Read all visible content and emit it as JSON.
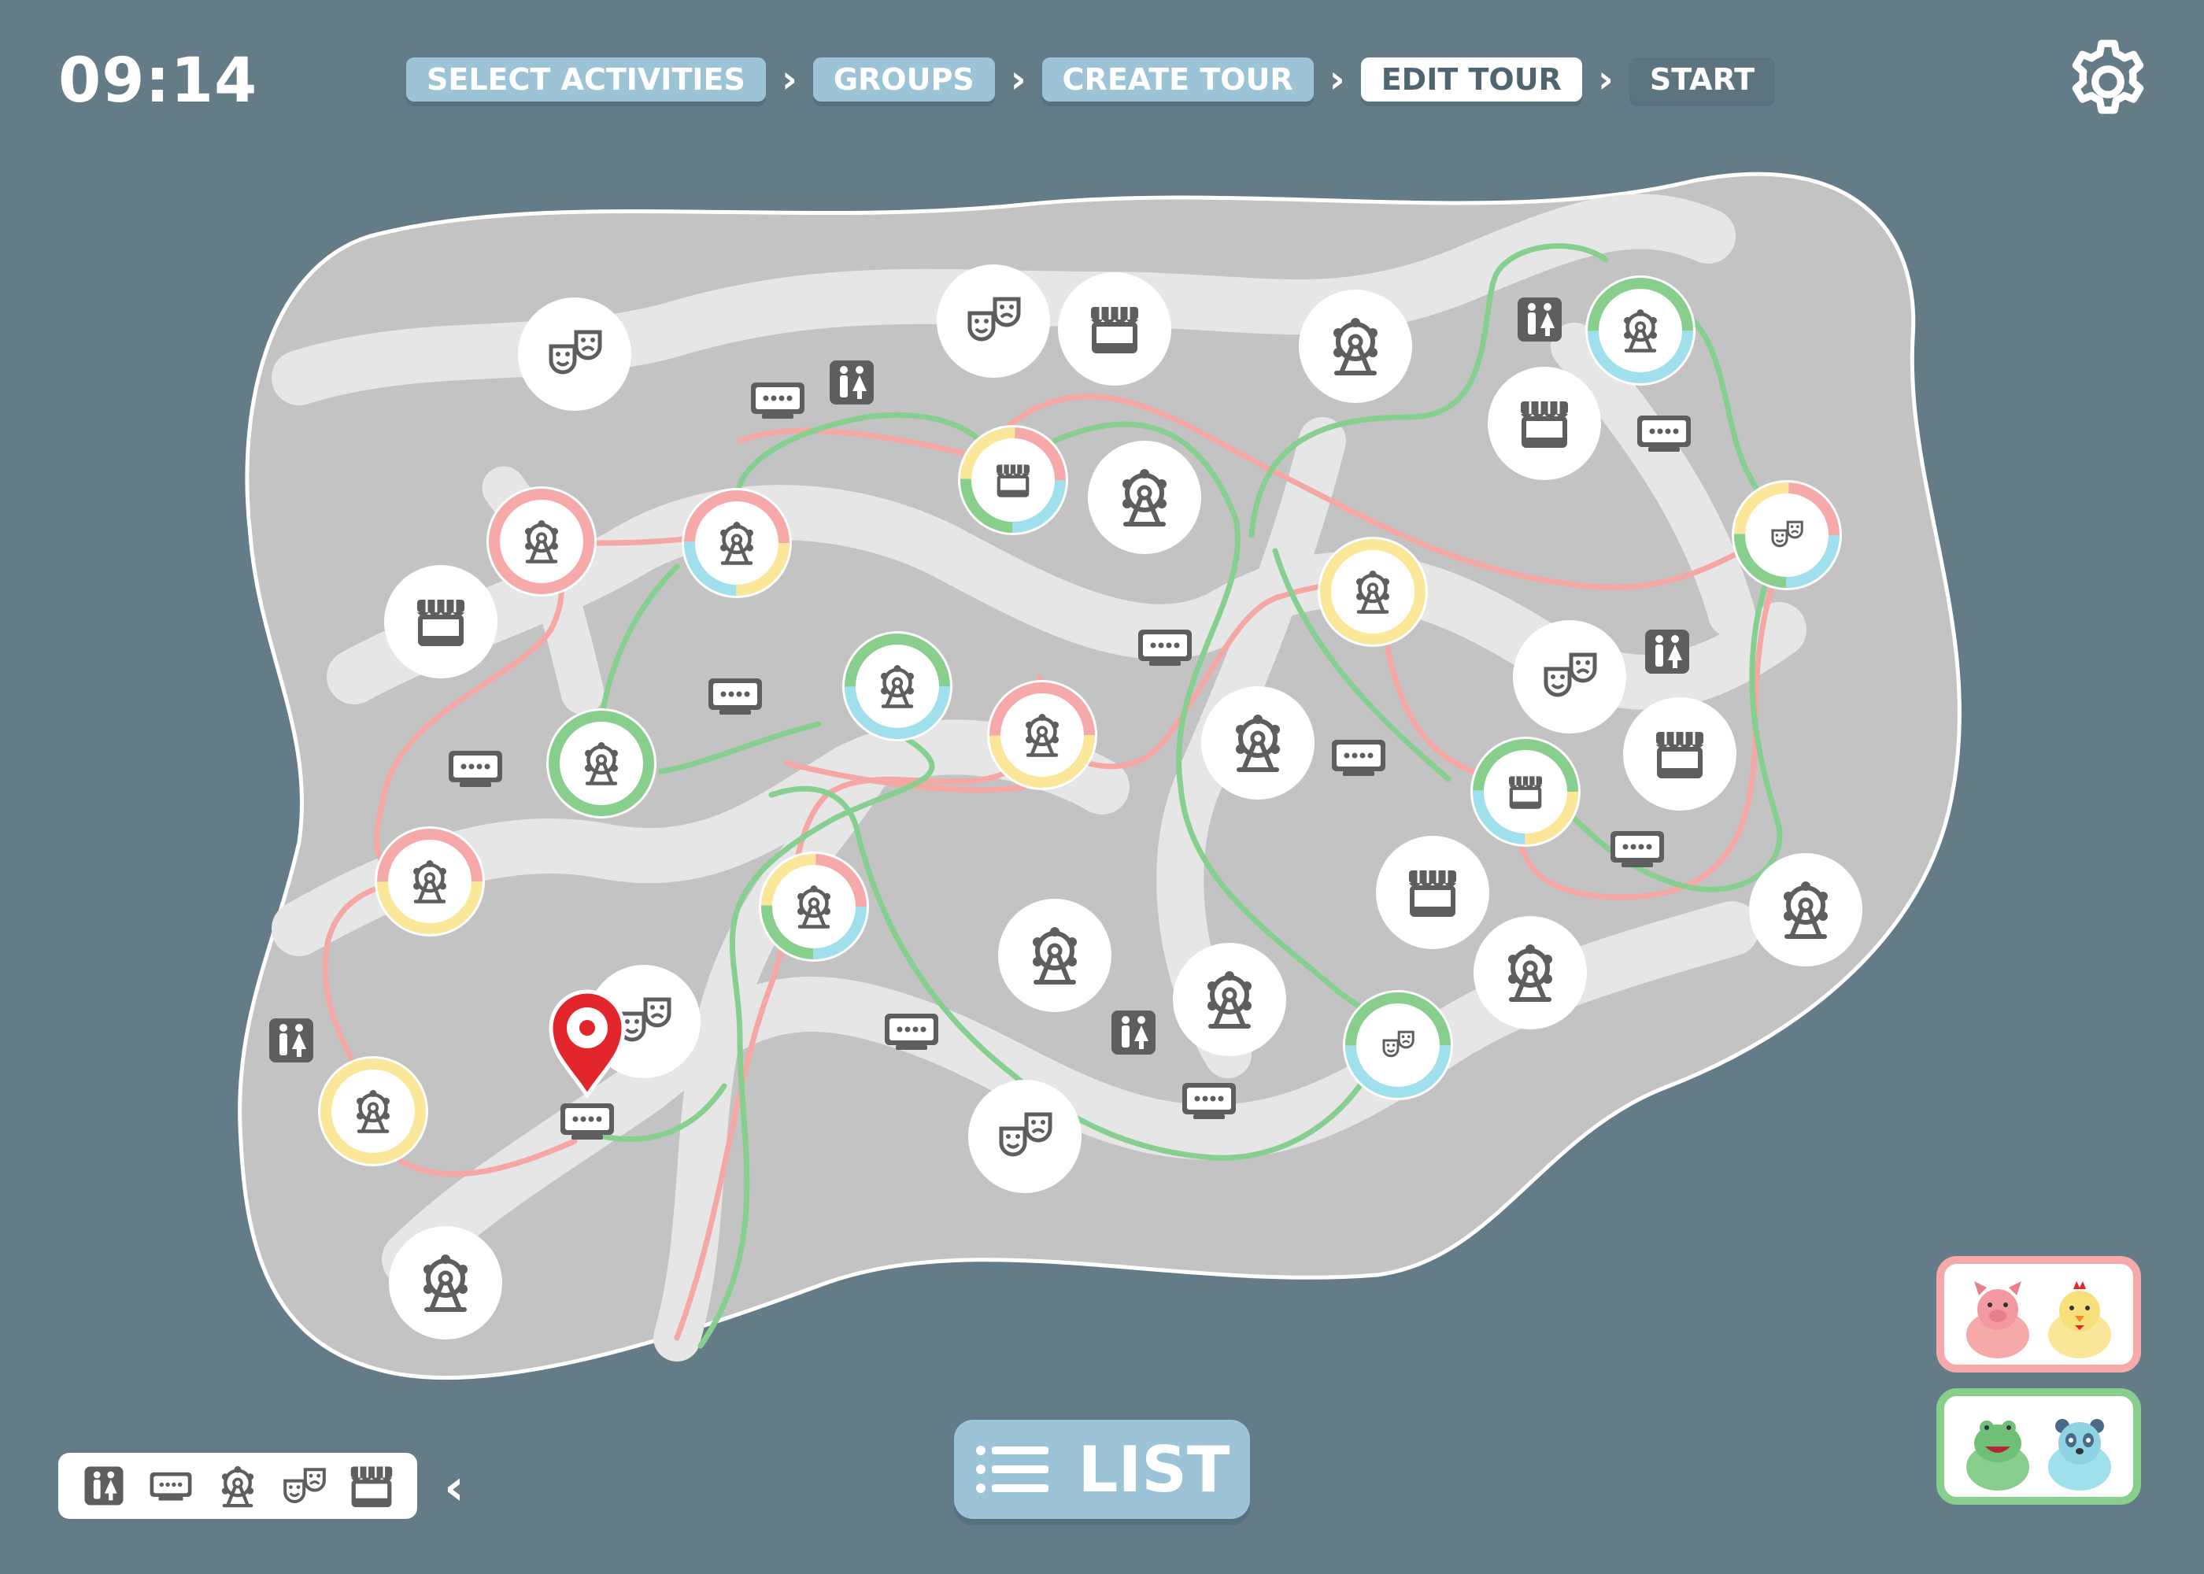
{
  "header": {
    "time": "09:14",
    "steps": [
      {
        "label": "SELECT ACTIVITIES",
        "state": "done"
      },
      {
        "label": "GROUPS",
        "state": "done"
      },
      {
        "label": "CREATE TOUR",
        "state": "done"
      },
      {
        "label": "EDIT TOUR",
        "state": "current"
      },
      {
        "label": "START",
        "state": "pending"
      }
    ],
    "settings_icon": "gear-icon"
  },
  "colors": {
    "background": "#647b88",
    "map_land": "#c3c3c3",
    "map_paths": "#e6e6e6",
    "route_pink": "#f4a7a3",
    "route_green": "#86cf8f",
    "group_pink": "#f5a9a8",
    "group_yellow": "#fbe79a",
    "group_cyan": "#9fe0ec",
    "group_green": "#88cf8e",
    "icon_dark": "#5e5e5e",
    "pin_red": "#e3262b",
    "button_blue": "#9cc4d6"
  },
  "map": {
    "icon_types": [
      "restroom-icon",
      "info-board-icon",
      "ferris-wheel-icon",
      "theater-masks-icon",
      "shop-stall-icon"
    ],
    "current_location_icon": "location-pin-icon"
  },
  "legend": {
    "items": [
      "restroom-icon",
      "info-board-icon",
      "ferris-wheel-icon",
      "theater-masks-icon",
      "shop-stall-icon"
    ],
    "collapse_icon": "chevron-left-icon"
  },
  "list_button": {
    "label": "LIST",
    "icon": "list-icon"
  },
  "groups": [
    {
      "name": "pink-yellow-group",
      "members": [
        "pig-avatar",
        "chick-avatar"
      ],
      "border": "#f5a9a8"
    },
    {
      "name": "green-cyan-group",
      "members": [
        "frog-avatar",
        "panda-avatar"
      ],
      "border": "#88cf8e"
    }
  ]
}
